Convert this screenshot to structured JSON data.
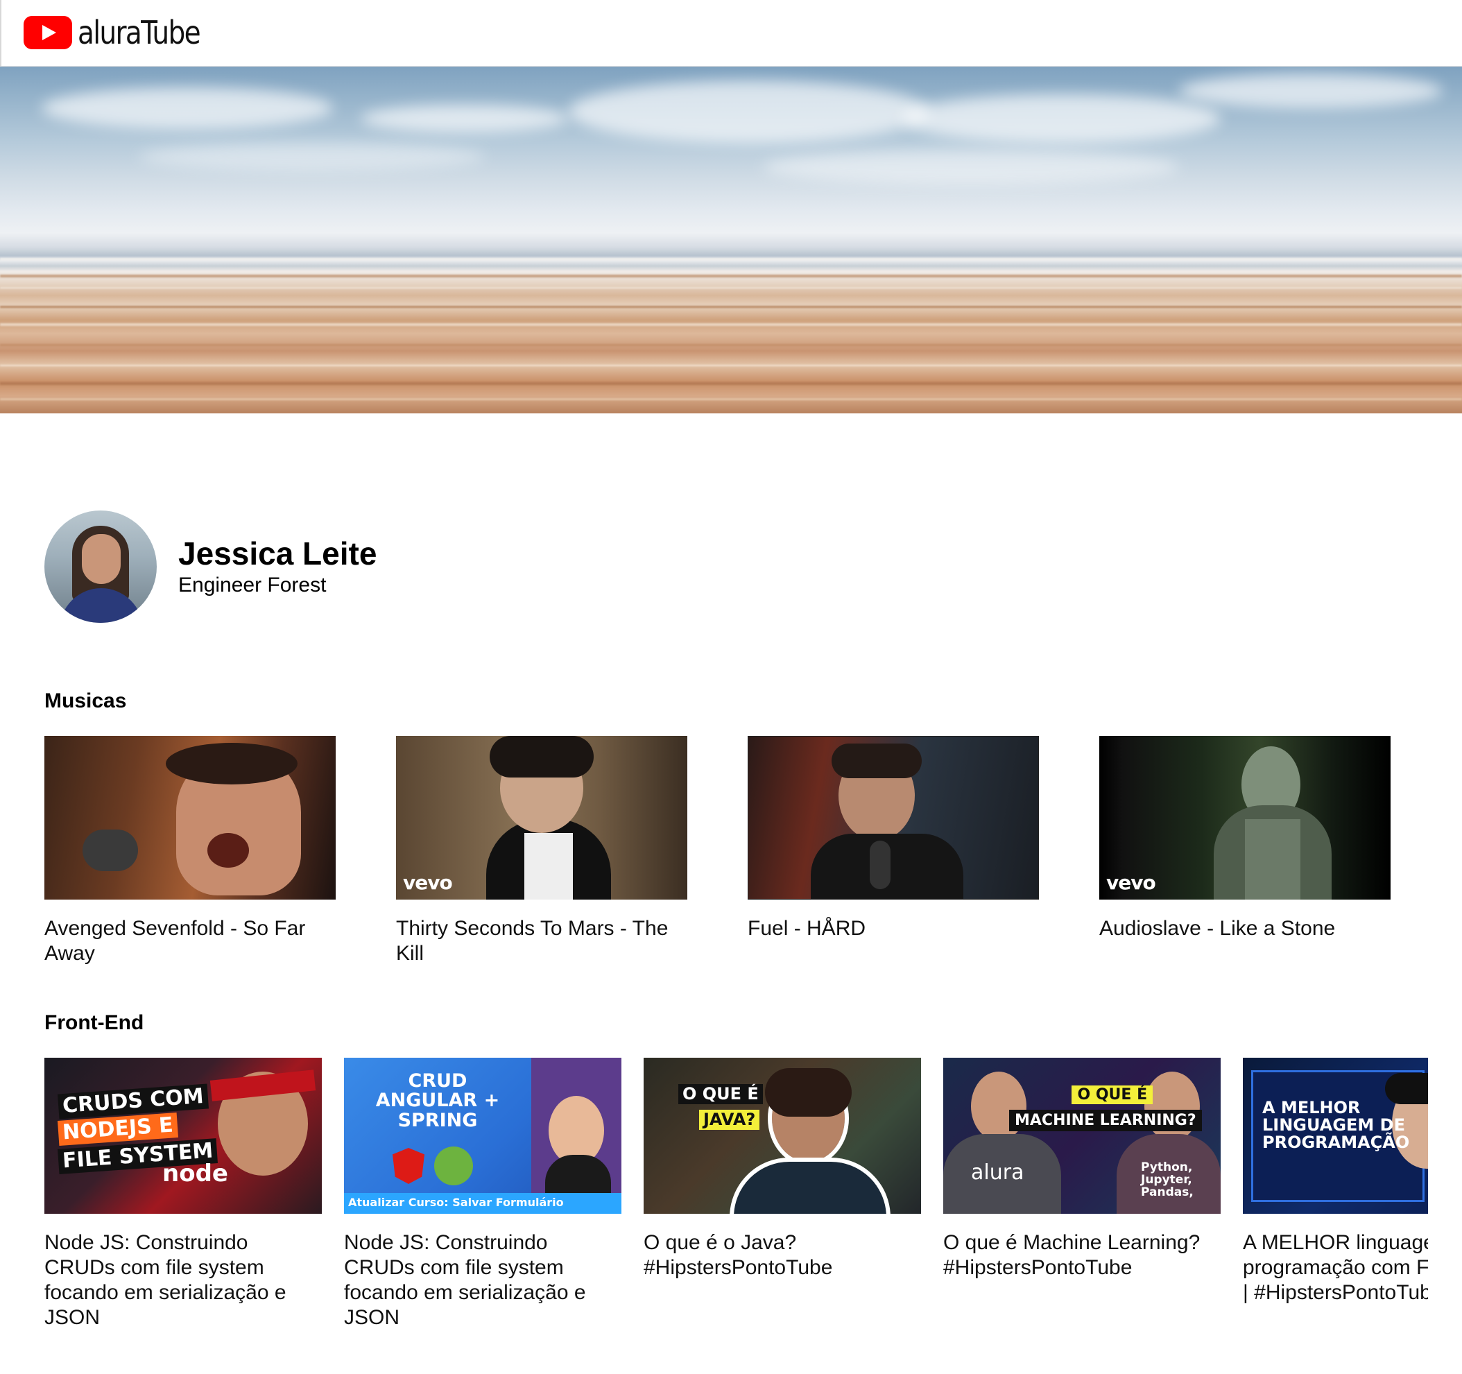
{
  "header": {
    "logo_text": "aluraTube"
  },
  "profile": {
    "name": "Jessica Leite",
    "role": "Engineer Forest"
  },
  "sections": [
    {
      "title": "Musicas",
      "videos": [
        {
          "title": "Avenged Sevenfold - So Far Away",
          "badge": ""
        },
        {
          "title": "Thirty Seconds To Mars - The Kill",
          "badge": "vevo"
        },
        {
          "title": "Fuel - HÅRD",
          "badge": ""
        },
        {
          "title": "Audioslave - Like a Stone",
          "badge": "vevo"
        }
      ]
    },
    {
      "title": "Front-End",
      "videos": [
        {
          "title": "Node JS: Construindo CRUDs com file system focando em serialização e JSON",
          "thumb_lines": [
            "CRUDS COM",
            "NODEJS E",
            "FILE SYSTEM"
          ],
          "thumb_badge": "node"
        },
        {
          "title": "Node JS: Construindo CRUDs com file system focando em serialização e JSON",
          "thumb_lines": [
            "CRUD",
            "ANGULAR +",
            "SPRING"
          ],
          "thumb_caption": "Atualizar Curso: Salvar Formulário"
        },
        {
          "title": "O que é o Java? #HipstersPontoTube",
          "thumb_lines": [
            "O QUE É",
            "JAVA?"
          ]
        },
        {
          "title": "O que é Machine Learning? #HipstersPontoTube",
          "thumb_lines": [
            "O QUE É",
            "MACHINE LEARNING?"
          ],
          "thumb_badge": "alura",
          "thumb_shirt": "Python, Jupyter, Pandas,"
        },
        {
          "title": "A MELHOR linguagem de programação com Fabio Akita | #HipstersPontoTube",
          "thumb_lines": [
            "A MELHOR",
            "LINGUAGEM DE",
            "PROGRAMAÇÃO"
          ]
        }
      ]
    }
  ],
  "colors": {
    "brand_red": "#ff0000",
    "text": "#111111"
  }
}
